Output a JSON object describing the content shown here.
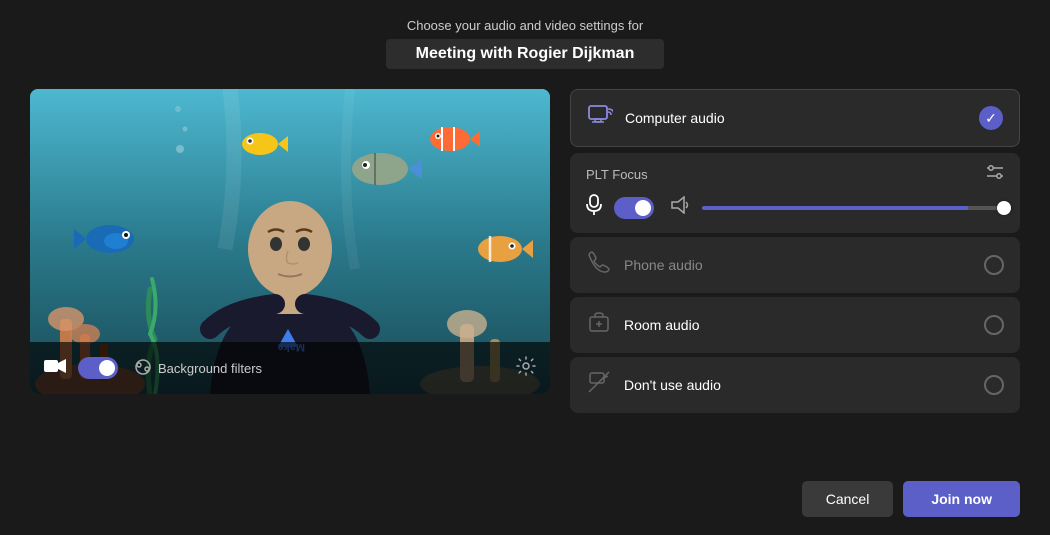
{
  "header": {
    "subtitle": "Choose your audio and video settings for",
    "title": "Meeting with Rogier Dijkman"
  },
  "video": {
    "camera_toggle": true,
    "bg_filters_label": "Background filters",
    "settings_icon": "⚙"
  },
  "audio_options": [
    {
      "id": "computer",
      "label": "Computer audio",
      "selected": true,
      "icon": "🖥"
    },
    {
      "id": "phone",
      "label": "Phone audio",
      "selected": false,
      "icon": "📞"
    },
    {
      "id": "room",
      "label": "Room audio",
      "selected": false,
      "icon": "🔔"
    },
    {
      "id": "none",
      "label": "Don't use audio",
      "selected": false,
      "icon": "🔇"
    }
  ],
  "plt": {
    "label": "PLT Focus",
    "mic_on": true,
    "volume": 88
  },
  "footer": {
    "cancel_label": "Cancel",
    "join_label": "Join now"
  }
}
